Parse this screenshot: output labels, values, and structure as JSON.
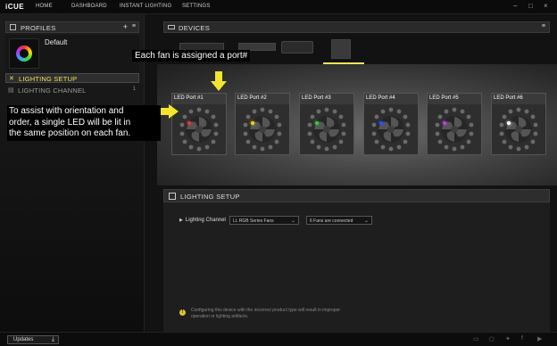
{
  "app": {
    "logo": "iCUE",
    "nav": [
      "HOME",
      "DASHBOARD",
      "INSTANT LIGHTING",
      "SETTINGS"
    ],
    "window_controls": [
      "–",
      "□",
      "×"
    ]
  },
  "profiles": {
    "title": "PROFILES",
    "add_label": "+",
    "menu_label": "≡",
    "profile_name": "Default",
    "items": [
      {
        "label": "LIGHTING SETUP",
        "icon": "wrench-icon"
      },
      {
        "label": "LIGHTING CHANNEL",
        "count": "1"
      }
    ]
  },
  "devices": {
    "title": "DEVICES",
    "menu_label": "≡"
  },
  "annotations": {
    "top": "Each fan is assigned a port#",
    "left_lines": [
      "To assist with orientation and",
      "order, a single LED will be lit in",
      "the same position on each fan."
    ]
  },
  "fans": [
    {
      "label": "LED Port #1",
      "led_color": "#e23b3b"
    },
    {
      "label": "LED Port #2",
      "led_color": "#f0d020"
    },
    {
      "label": "LED Port #3",
      "led_color": "#2ecc40"
    },
    {
      "label": "LED Port #4",
      "led_color": "#2a4fff"
    },
    {
      "label": "LED Port #5",
      "led_color": "#c040e0"
    },
    {
      "label": "LED Port #6",
      "led_color": "#ffffff"
    }
  ],
  "lighting_setup": {
    "title": "LIGHTING SETUP",
    "channel_label": "Lighting Channel",
    "fan_type": "LL RGB Series Fans",
    "fan_count": "6 Fans are connected",
    "warning": "Configuring this device with the incorrect product type will result in improper operation or lighting artifacts."
  },
  "footer": {
    "updates_label": "Updates",
    "social_icons": [
      "chat-icon",
      "forum-icon",
      "twitter-icon",
      "facebook-icon",
      "youtube-icon"
    ]
  },
  "colors": {
    "accent": "#f3e25a",
    "background": "#121212"
  }
}
